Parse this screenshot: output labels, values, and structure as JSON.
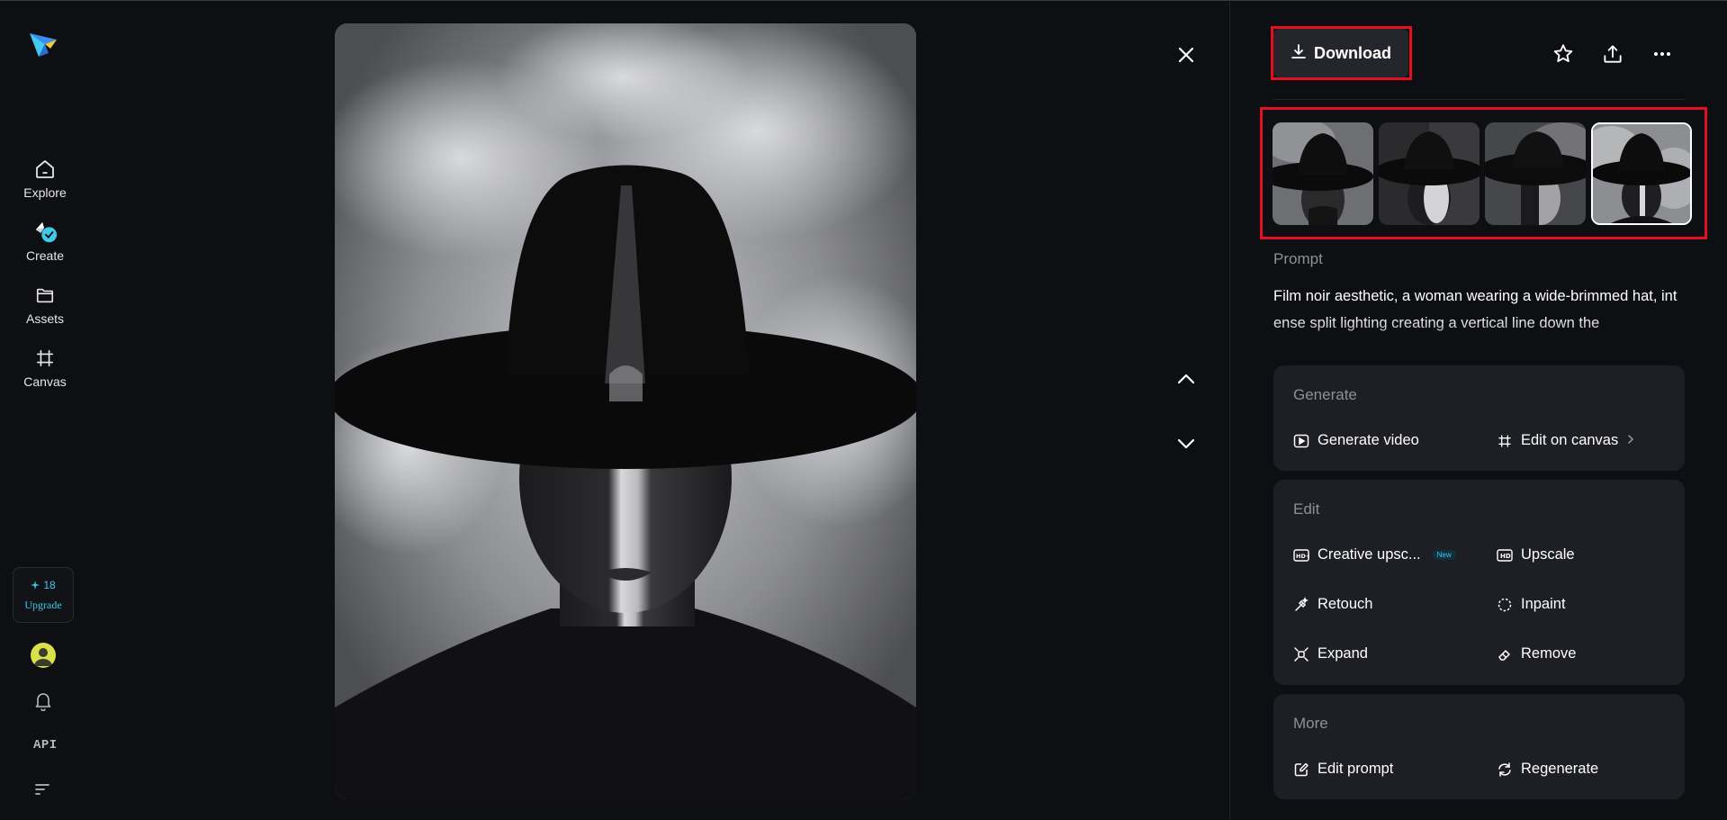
{
  "sidebar": {
    "items": [
      {
        "label": "Explore",
        "icon": "home-icon"
      },
      {
        "label": "Create",
        "icon": "create-icon"
      },
      {
        "label": "Assets",
        "icon": "folder-icon"
      },
      {
        "label": "Canvas",
        "icon": "canvas-icon"
      }
    ],
    "credits": "18",
    "upgrade_label": "Upgrade",
    "api_label": "API"
  },
  "viewer": {
    "close_icon": "close-icon",
    "prev_icon": "chevron-up-icon",
    "next_icon": "chevron-down-icon"
  },
  "panel": {
    "download_label": "Download",
    "top_icons": [
      "star-icon",
      "share-icon",
      "more-icon"
    ],
    "thumbnails_count_selected_index": 3,
    "prompt_label": "Prompt",
    "prompt_text": "Film noir aesthetic, a woman wearing a wide-brimmed hat, intense split lighting creating a vertical line down the",
    "generate": {
      "title": "Generate",
      "generate_video": "Generate video",
      "edit_on_canvas": "Edit on canvas"
    },
    "edit": {
      "title": "Edit",
      "creative_upscale": "Creative upsc...",
      "new_badge": "New",
      "upscale": "Upscale",
      "retouch": "Retouch",
      "inpaint": "Inpaint",
      "expand": "Expand",
      "remove": "Remove"
    },
    "more": {
      "title": "More",
      "edit_prompt": "Edit prompt",
      "regenerate": "Regenerate"
    }
  },
  "colors": {
    "background": "#0e0f12",
    "card": "#1e1f24",
    "accent": "#3fc8e8",
    "highlight": "#e3101e"
  }
}
